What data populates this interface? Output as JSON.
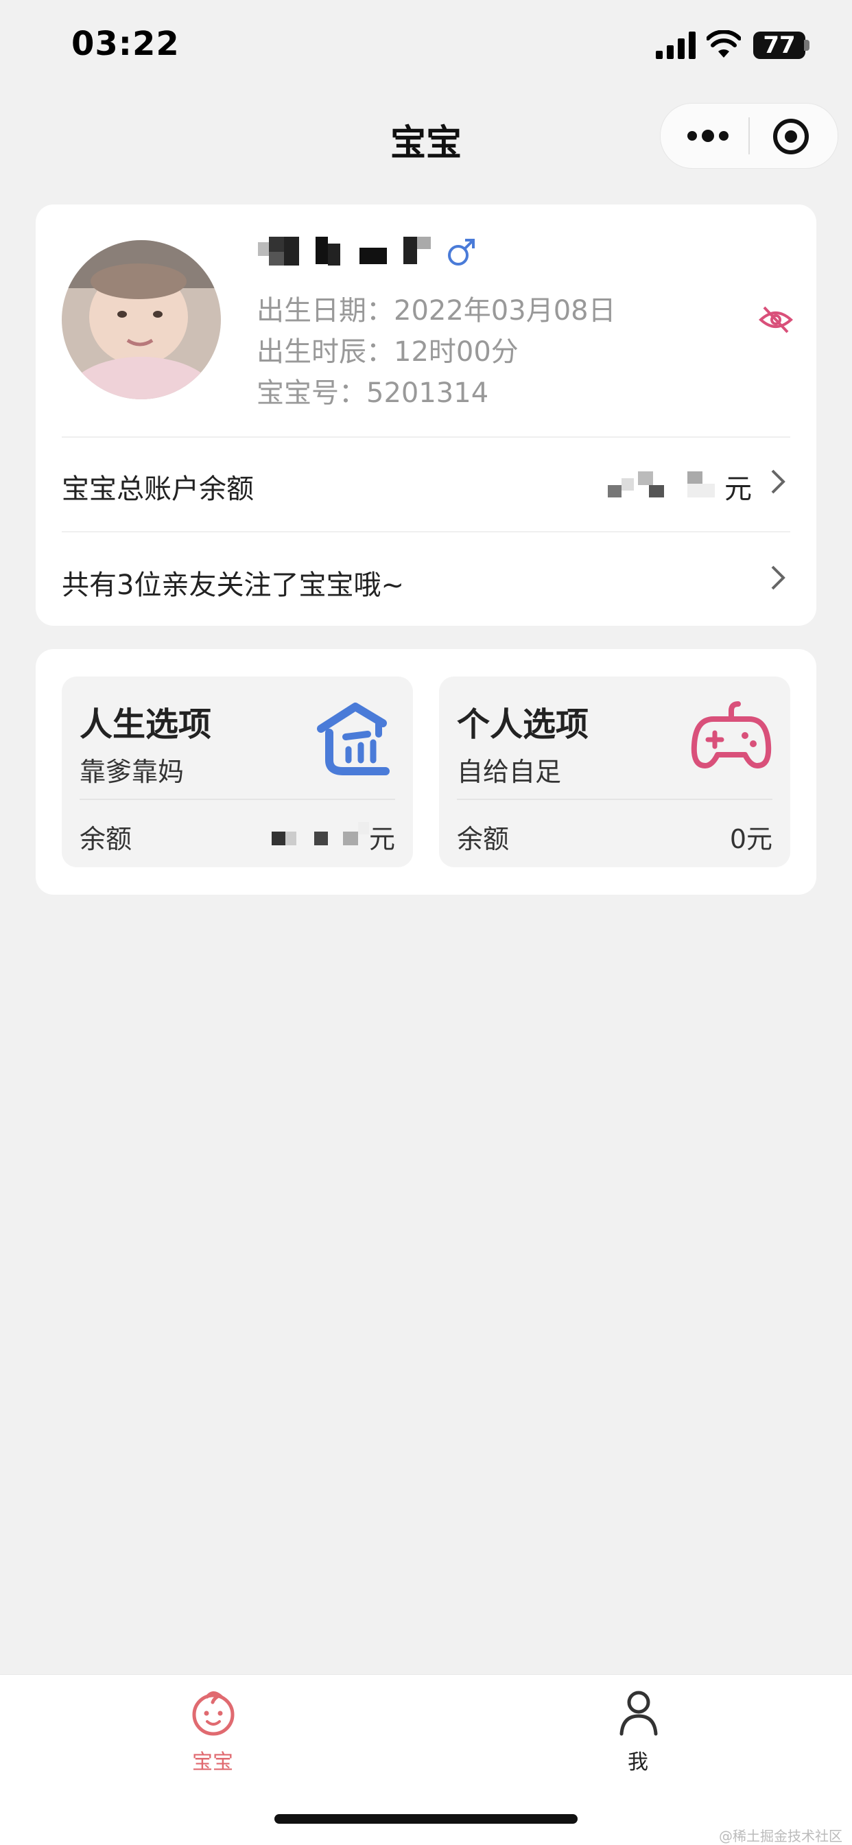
{
  "status_bar": {
    "time": "03:22",
    "battery": "77"
  },
  "nav": {
    "title": "宝宝"
  },
  "profile": {
    "birth_date": "出生日期：2022年03月08日",
    "birth_time": "出生时辰：12时00分",
    "baby_id": "宝宝号：5201314",
    "gender_symbol": "♂",
    "gender_color": "#4a7bd8",
    "eye_icon_color": "#d9507a"
  },
  "account": {
    "label": "宝宝总账户余额",
    "unit": "元"
  },
  "followers": {
    "text": "共有3位亲友关注了宝宝哦~"
  },
  "options": [
    {
      "title": "人生选项",
      "subtitle": "靠爹靠妈",
      "balance_label": "余额",
      "unit": "元",
      "icon": "house-icon",
      "icon_color": "#4a7bd8"
    },
    {
      "title": "个人选项",
      "subtitle": "自给自足",
      "balance_label": "余额",
      "value": "0元",
      "icon": "gamepad-icon",
      "icon_color": "#d9507a"
    }
  ],
  "tabs": [
    {
      "label": "宝宝",
      "active": true,
      "color": "#e06a70"
    },
    {
      "label": "我",
      "active": false,
      "color": "#222222"
    }
  ],
  "watermark": "@稀土掘金技术社区"
}
